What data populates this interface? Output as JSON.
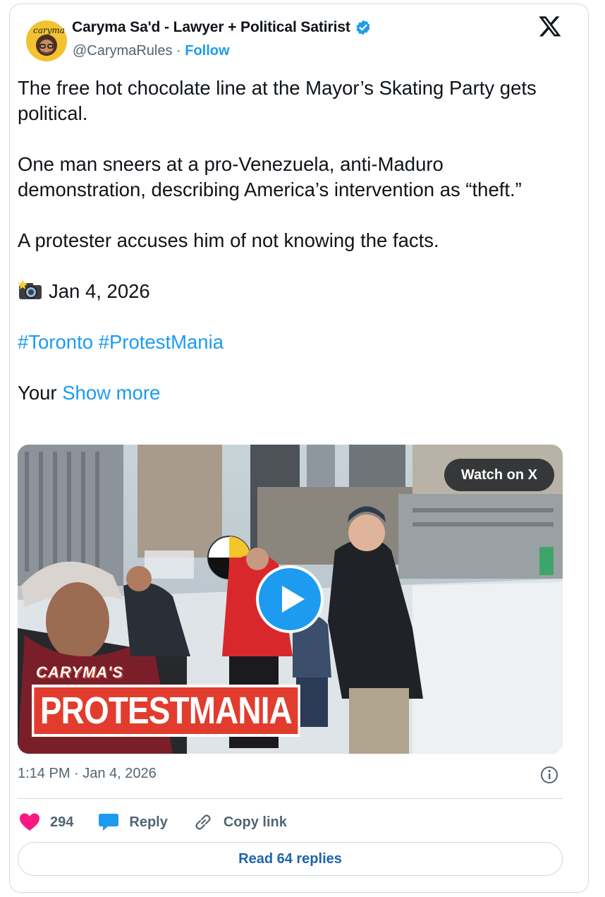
{
  "author": {
    "name": "Caryma Sa'd - Lawyer + Political Satirist",
    "handle": "@CarymaRules",
    "separator": " · ",
    "follow_label": "Follow",
    "avatar_text": "caryma"
  },
  "tweet": {
    "paragraphs": [
      "The free hot chocolate line at the Mayor’s Skating Party gets political.",
      "One man sneers at a pro-Venezuela, anti-Maduro demonstration, describing America’s intervention as “theft.”",
      "A protester accuses him of not knowing the facts."
    ],
    "date_line": "Jan 4, 2026",
    "hashtags": [
      "#Toronto",
      "#ProtestMania"
    ],
    "truncated_word": "Your",
    "show_more_label": "Show more"
  },
  "media": {
    "watch_label": "Watch on X",
    "brand_small": "CARYMA'S",
    "brand_main": "PROTESTMANIA"
  },
  "meta": {
    "timestamp": "1:14 PM · Jan 4, 2026"
  },
  "actions": {
    "like_count": "294",
    "reply_label": "Reply",
    "copy_link_label": "Copy link"
  },
  "read_replies_label": "Read 64 replies",
  "colors": {
    "accent": "#1d9bf0",
    "like": "#f91880",
    "brand_red": "#e23c2e"
  },
  "icons": [
    "verified-badge-icon",
    "x-logo-icon",
    "camera-flash-icon",
    "play-icon",
    "info-icon",
    "heart-icon",
    "reply-bubble-icon",
    "link-icon"
  ]
}
